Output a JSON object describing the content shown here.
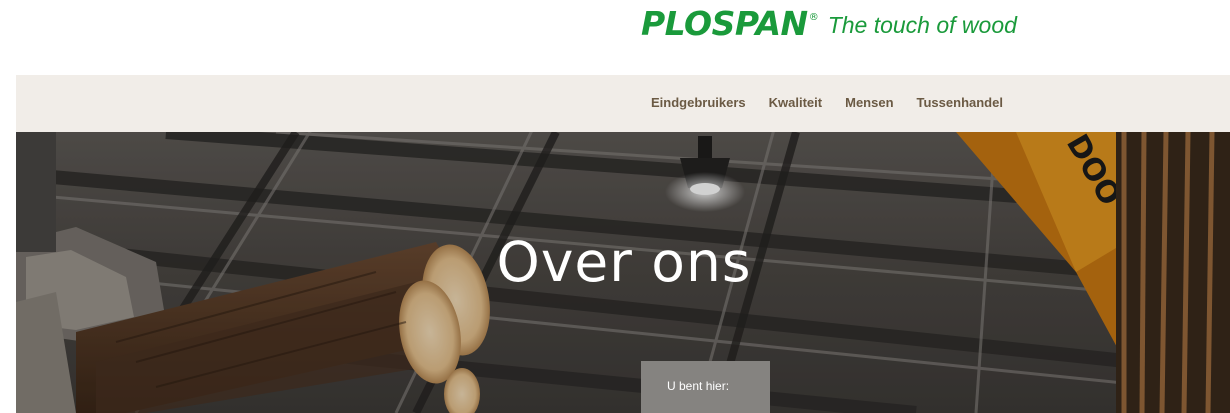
{
  "brand": {
    "name": "PLOSPAN",
    "registered_mark": "®",
    "tagline": "The touch of wood",
    "color": "#1a9a3b"
  },
  "nav": {
    "items": [
      {
        "label": "Eindgebruikers"
      },
      {
        "label": "Kwaliteit"
      },
      {
        "label": "Mensen"
      },
      {
        "label": "Tussenhandel"
      }
    ],
    "background": "#f1ede8",
    "text_color": "#6b5a44"
  },
  "hero": {
    "title": "Over ons",
    "breadcrumb_label": "U bent hier:"
  }
}
